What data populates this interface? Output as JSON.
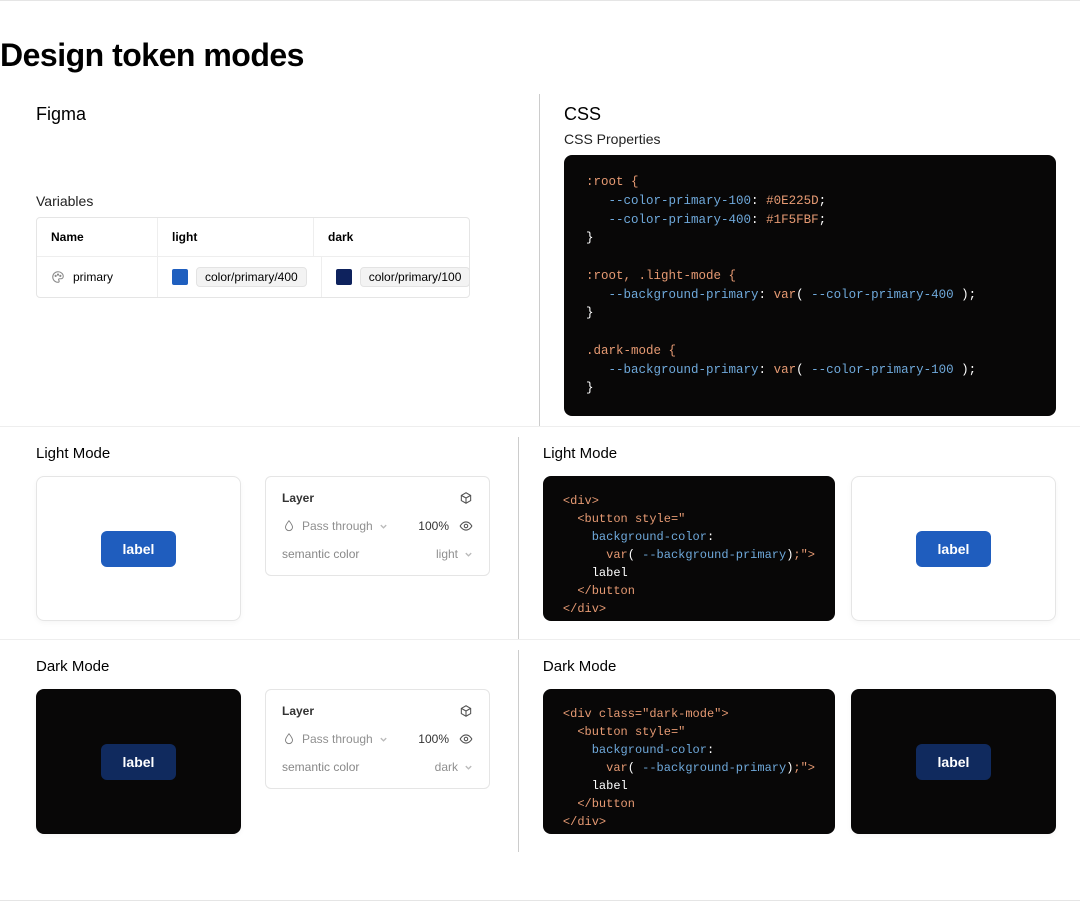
{
  "title": "Design token modes",
  "figma": {
    "heading": "Figma",
    "variables_label": "Variables",
    "table": {
      "headers": {
        "name": "Name",
        "light": "light",
        "dark": "dark"
      },
      "row": {
        "name": "primary",
        "light_swatch": "#1F5FBF",
        "light_label": "color/primary/400",
        "dark_swatch": "#0E225D",
        "dark_label": "color/primary/100"
      }
    }
  },
  "css": {
    "heading": "CSS",
    "props_heading": "CSS Properties",
    "code": {
      "root_open": ":root {",
      "v100": "--color-primary-100",
      "v100_val": "#0E225D",
      "v400": "--color-primary-400",
      "v400_val": "#1F5FBF",
      "close1": "}",
      "light_open": ":root, .light-mode {",
      "bg_prop": "--background-primary",
      "var_fn": "var",
      "var400": "--color-primary-400",
      "close2": "}",
      "dark_open": ".dark-mode {",
      "var100": "--color-primary-100",
      "close3": "}",
      "semi": ";"
    }
  },
  "light_mode": {
    "title": "Light Mode",
    "button_label": "label",
    "layer": {
      "title": "Layer",
      "blend": "Pass through",
      "opacity": "100%",
      "sc_label": "semantic color",
      "sc_value": "light"
    }
  },
  "dark_mode": {
    "title": "Dark Mode",
    "button_label": "label",
    "layer": {
      "title": "Layer",
      "blend": "Pass through",
      "opacity": "100%",
      "sc_label": "semantic color",
      "sc_value": "dark"
    }
  },
  "snippet": {
    "div_open": "<div>",
    "div_dark_open": "<div class=\"dark-mode\">",
    "btn_open": "<button style=\"",
    "bgcolor": "background-color",
    "var_fn": "var",
    "var_name": "--background-primary",
    "close_tag": ";\">",
    "label": "label",
    "btn_close": "</button",
    "div_close": "</div>"
  }
}
